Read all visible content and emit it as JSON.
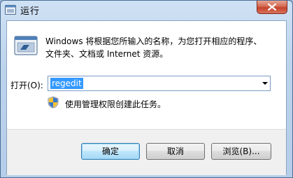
{
  "window": {
    "title": "运行"
  },
  "dialog": {
    "description_line1": "Windows 将根据您所输入的名称，为您打开相应的程序、",
    "description_line2": "文件夹、文档或 Internet 资源。",
    "open_label": "打开(O):",
    "open_value": "regedit",
    "admin_notice": "使用管理权限创建此任务。"
  },
  "buttons": {
    "ok": "确定",
    "cancel": "取消",
    "browse": "浏览(B)..."
  },
  "icons": {
    "title": "run-icon",
    "main": "run-icon",
    "admin": "uac-shield-icon",
    "close": "close-icon",
    "dropdown": "chevron-down-icon"
  },
  "colors": {
    "selection": "#3399ff",
    "close_button": "#c4422a",
    "default_button_border": "#3c7fb1"
  }
}
